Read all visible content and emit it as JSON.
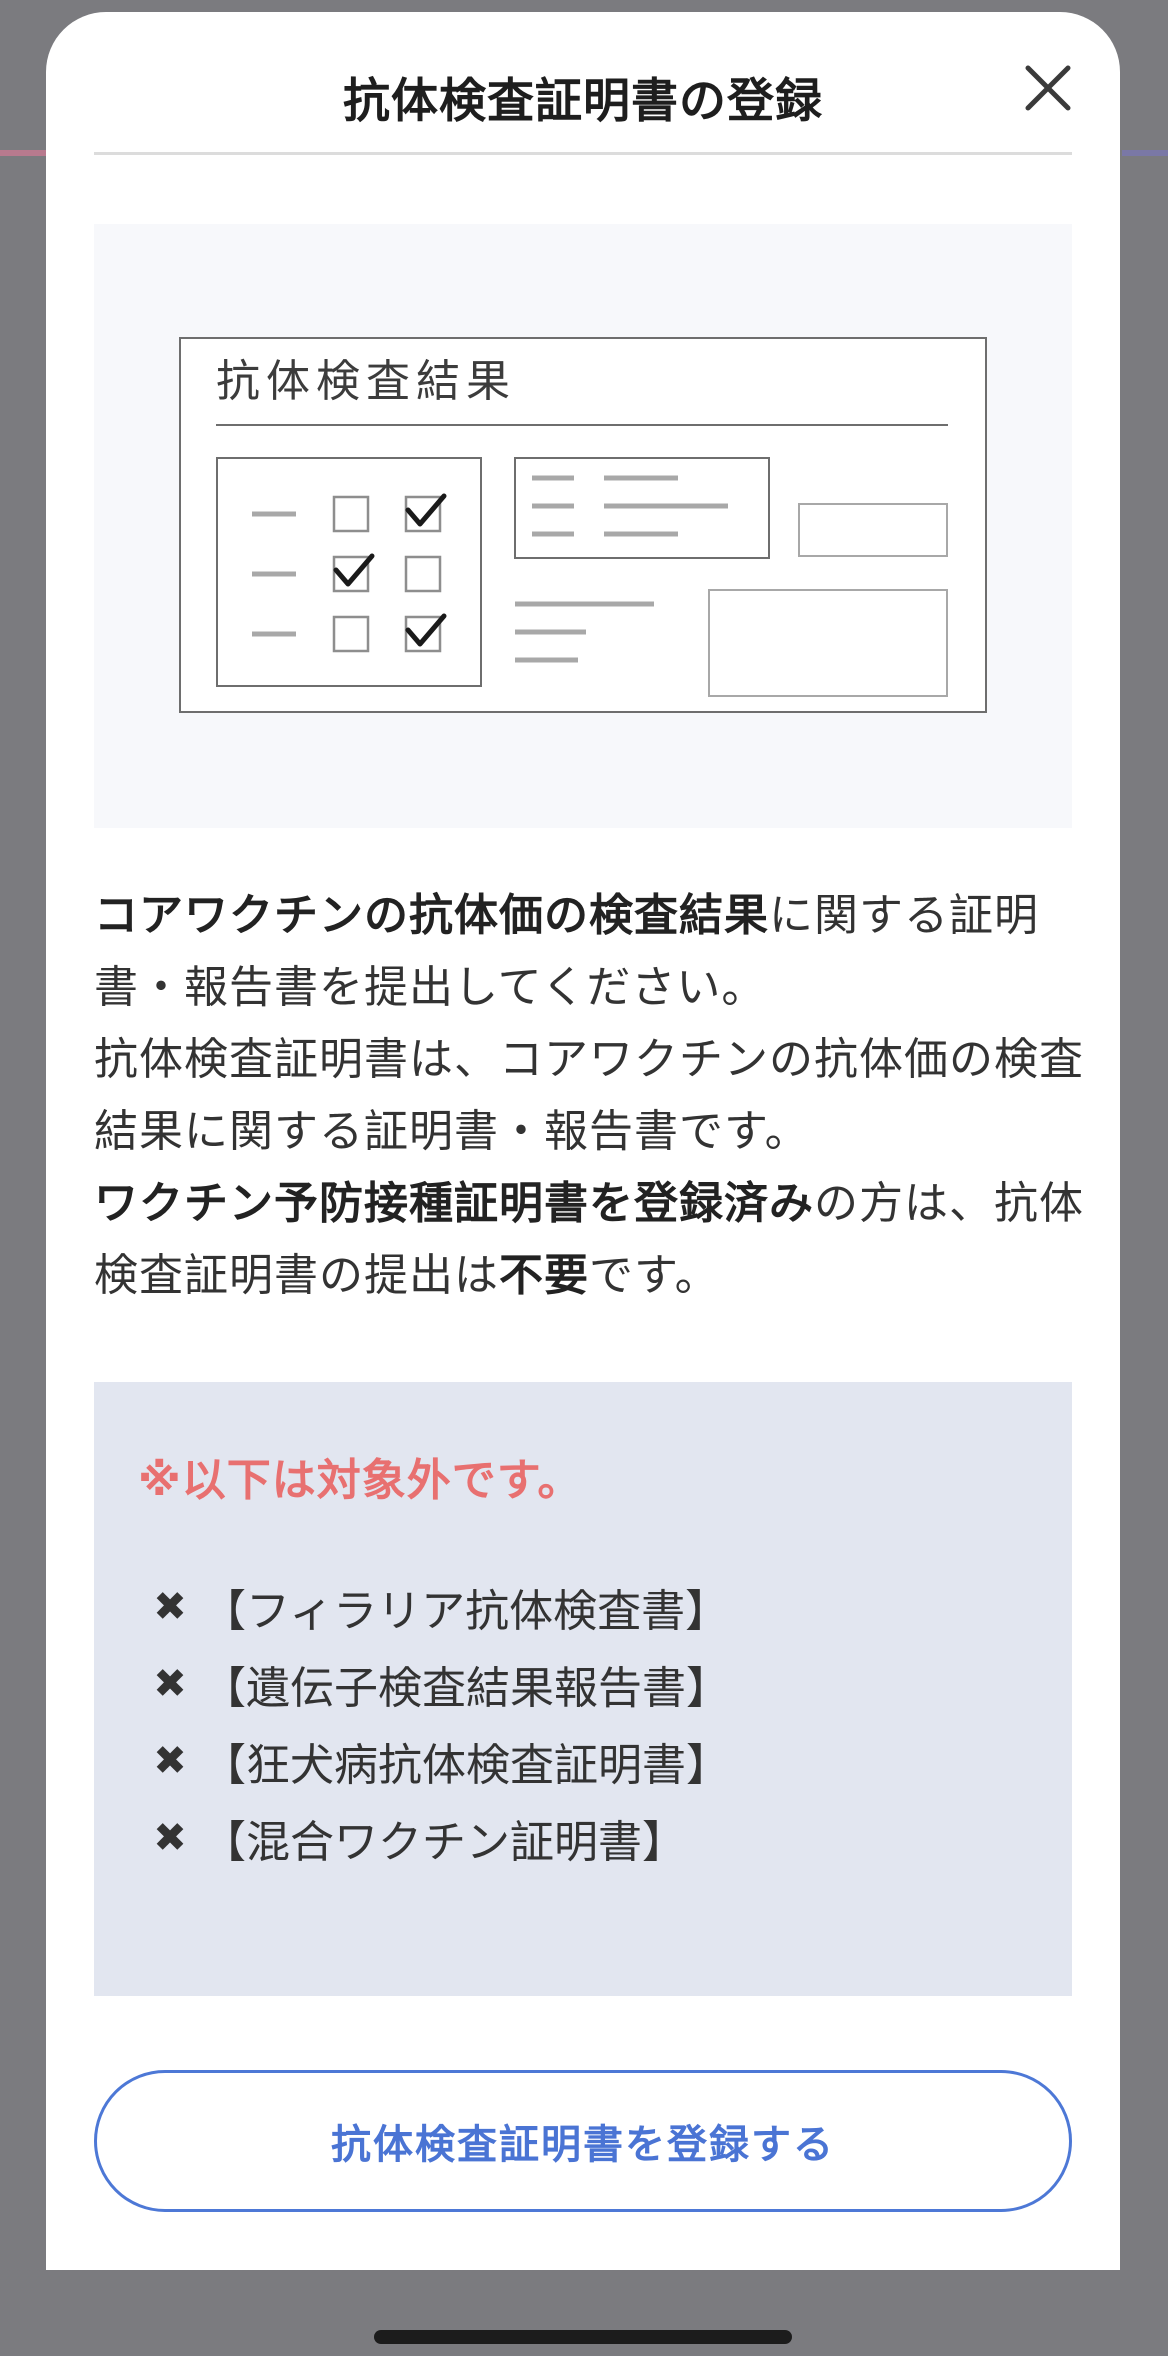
{
  "modal": {
    "title": "抗体検査証明書の登録",
    "close_icon": "close-icon"
  },
  "illustration": {
    "document_heading": "抗体検査結果"
  },
  "description": {
    "line1_bold": "コアワクチンの抗体価の検査結果",
    "line1_rest": "に関する証明書・報告書を提出してください。",
    "line2": "抗体検査証明書は、コアワクチンの抗体価の検査結果に関する証明書・報告書です。",
    "line3_bold": "ワクチン予防接種証明書を登録済み",
    "line3_mid": "の方は、抗体検査証明書の提出は",
    "line3_bold2": "不要",
    "line3_end": "です。"
  },
  "excluded": {
    "heading": "※以下は対象外です。",
    "mark": "✖",
    "items": [
      "【フィラリア抗体検査書】",
      "【遺伝子検査結果報告書】",
      "【狂犬病抗体検査証明書】",
      "【混合ワクチン証明書】"
    ]
  },
  "register_button": {
    "label": "抗体検査証明書を登録する"
  },
  "colors": {
    "accent_blue": "#4a74d4",
    "warning_red": "#e87070",
    "excluded_bg": "#e2e6f0"
  }
}
